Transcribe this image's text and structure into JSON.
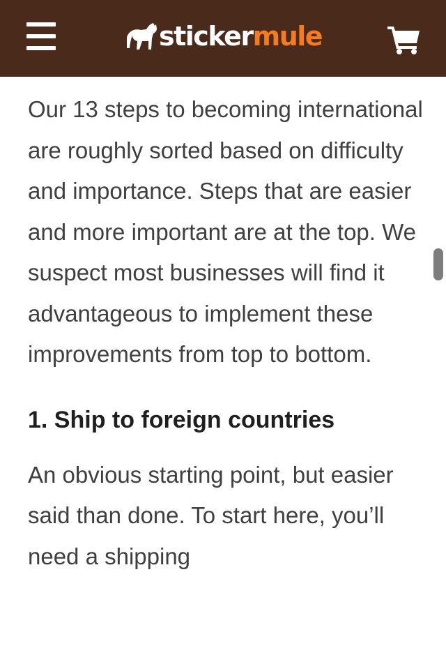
{
  "header": {
    "logo": {
      "part1": "sticker",
      "part2": "mule"
    },
    "menu_icon": "hamburger-menu-icon",
    "cart_icon": "shopping-cart-icon",
    "bg_color": "#4a2a1a",
    "accent_color": "#f47b20"
  },
  "article": {
    "intro": "Our 13 steps to becoming international are roughly sorted based on difficulty and importance. Steps that are easier and more important are at the top. We suspect most businesses will find it advantageous to implement these improvements from top to bottom.",
    "heading_1": "1. Ship to foreign countries",
    "para_1": "An obvious starting point, but easier said than done. To start here, you’ll need a shipping"
  }
}
